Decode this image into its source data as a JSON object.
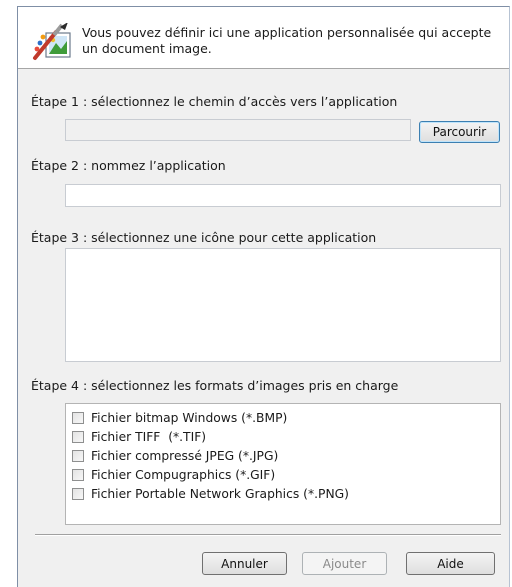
{
  "header": {
    "description": "Vous pouvez définir ici une application personnalisée qui accepte un document image.",
    "icon": "paint-brush-app-icon"
  },
  "step1": {
    "label": "Étape 1 : sélectionnez le chemin d’accès vers l’application",
    "path_value": "",
    "browse_label": "Parcourir"
  },
  "step2": {
    "label": "Étape 2 : nommez l’application",
    "name_value": ""
  },
  "step3": {
    "label": "Étape 3 : sélectionnez une icône pour cette application"
  },
  "step4": {
    "label": "Étape 4 : sélectionnez les formats d’images pris en charge",
    "formats": [
      {
        "label": "Fichier bitmap Windows (*.BMP)",
        "checked": false
      },
      {
        "label": "Fichier TIFF  (*.TIF)",
        "checked": false
      },
      {
        "label": "Fichier compressé JPEG (*.JPG)",
        "checked": false
      },
      {
        "label": "Fichier Compugraphics (*.GIF)",
        "checked": false
      },
      {
        "label": "Fichier Portable Network Graphics (*.PNG)",
        "checked": false
      }
    ]
  },
  "footer": {
    "cancel_label": "Annuler",
    "add_label": "Ajouter",
    "help_label": "Aide"
  },
  "colors": {
    "dialog_bg": "#f0f0f0",
    "header_bg": "#ffffff",
    "focus_border": "#3c7fb1"
  }
}
